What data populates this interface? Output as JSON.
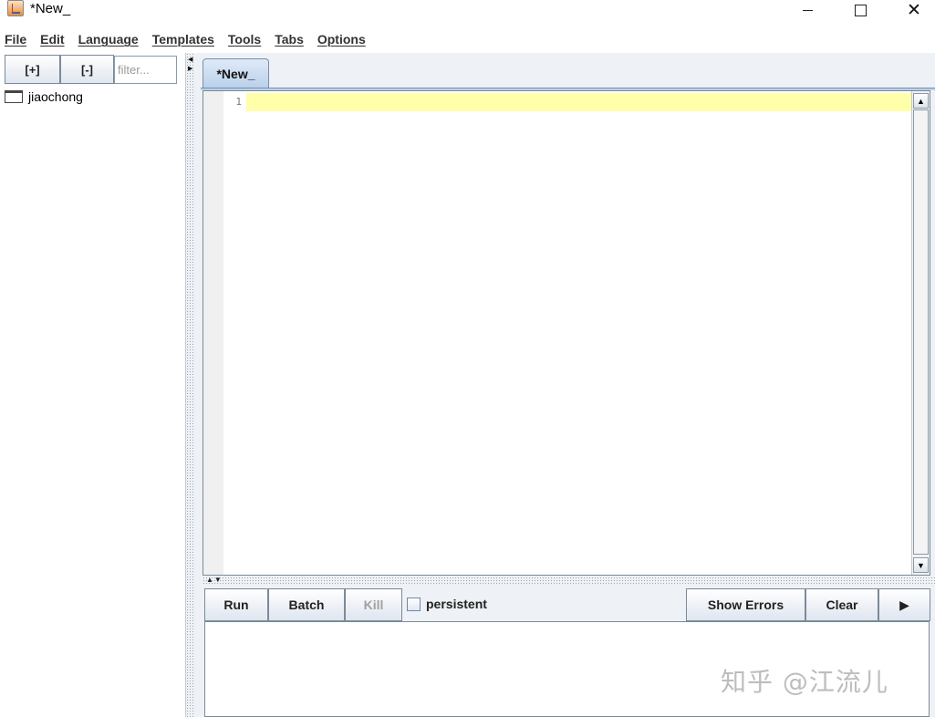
{
  "window": {
    "title": "*New_",
    "close_glyph": "✕"
  },
  "menu": {
    "items": [
      "File",
      "Edit",
      "Language",
      "Templates",
      "Tools",
      "Tabs",
      "Options"
    ]
  },
  "sidebar": {
    "expand_label": "[+]",
    "collapse_label": "[-]",
    "filter_placeholder": "filter...",
    "tree_items": [
      "jiaochong"
    ]
  },
  "editor": {
    "tab_label": "*New_",
    "line_numbers": [
      "1"
    ],
    "current_line_color": "#ffffaa"
  },
  "console": {
    "run_label": "Run",
    "batch_label": "Batch",
    "kill_label": "Kill",
    "persistent_label": "persistent",
    "persistent_checked": false,
    "show_errors_label": "Show Errors",
    "clear_label": "Clear",
    "play_glyph": "▶"
  },
  "watermark": {
    "text": "知乎 @江流儿"
  }
}
